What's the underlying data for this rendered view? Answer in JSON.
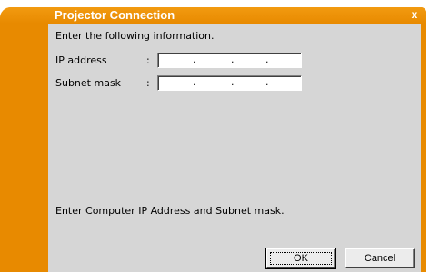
{
  "dialog": {
    "title": "Projector Connection",
    "close_glyph": "x",
    "instruction": "Enter the following information.",
    "fields": [
      {
        "label": "IP address",
        "separator": ":",
        "value": ". . ."
      },
      {
        "label": "Subnet mask",
        "separator": ":",
        "value": ". . ."
      }
    ],
    "hint": "Enter Computer IP Address and Subnet mask.",
    "ok_label": "OK",
    "cancel_label": "Cancel"
  },
  "colors": {
    "frame": "#e88a00",
    "client": "#d6d6d6"
  }
}
